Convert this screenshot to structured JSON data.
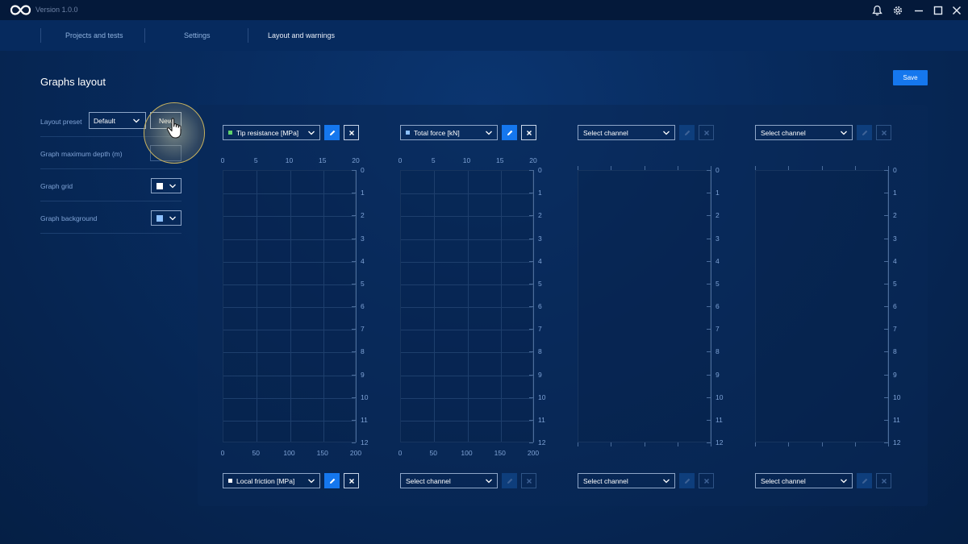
{
  "app": {
    "version": "Version 1.0.0"
  },
  "nav": {
    "tabs": [
      {
        "label": "Projects and tests"
      },
      {
        "label": "Settings"
      },
      {
        "label": "Layout and warnings"
      }
    ],
    "active_tab": "Layout and warnings"
  },
  "page": {
    "title": "Graphs layout",
    "save_label": "Save"
  },
  "settings": {
    "layout_preset_label": "Layout preset",
    "layout_preset_value": "Default",
    "new_label": "New",
    "max_depth_label": "Graph maximum depth (m)",
    "max_depth_value": "",
    "grid_label": "Graph grid",
    "grid_color": "#ffffff",
    "background_label": "Graph background",
    "background_color": "#8cc0ff"
  },
  "graphs": [
    {
      "top_channel": {
        "label": "Tip resistance [MPa]",
        "color": "#5fd16a",
        "active": true
      },
      "bottom_channel": {
        "label": "Local friction [MPa]",
        "color": "#ffffff",
        "active": true
      },
      "top_ticks": [
        "0",
        "5",
        "10",
        "15",
        "20"
      ],
      "bottom_ticks": [
        "0",
        "50",
        "100",
        "150",
        "200"
      ],
      "depth_ticks": [
        "0",
        "1",
        "2",
        "3",
        "4",
        "5",
        "6",
        "7",
        "8",
        "9",
        "10",
        "11",
        "12"
      ]
    },
    {
      "top_channel": {
        "label": "Total force [kN]",
        "color": "#8cc0ff",
        "active": true
      },
      "bottom_channel": {
        "label": "Select channel",
        "color": "",
        "active": false
      },
      "top_ticks": [
        "0",
        "5",
        "10",
        "15",
        "20"
      ],
      "bottom_ticks": [
        "0",
        "50",
        "100",
        "150",
        "200"
      ],
      "depth_ticks": [
        "0",
        "1",
        "2",
        "3",
        "4",
        "5",
        "6",
        "7",
        "8",
        "9",
        "10",
        "11",
        "12"
      ]
    },
    {
      "top_channel": {
        "label": "Select channel",
        "color": "",
        "active": false
      },
      "bottom_channel": {
        "label": "Select channel",
        "color": "",
        "active": false
      },
      "top_ticks": [],
      "bottom_ticks": [],
      "depth_ticks": [
        "0",
        "1",
        "2",
        "3",
        "4",
        "5",
        "6",
        "7",
        "8",
        "9",
        "10",
        "11",
        "12"
      ]
    },
    {
      "top_channel": {
        "label": "Select channel",
        "color": "",
        "active": false
      },
      "bottom_channel": {
        "label": "Select channel",
        "color": "",
        "active": false
      },
      "top_ticks": [],
      "bottom_ticks": [],
      "depth_ticks": [
        "0",
        "1",
        "2",
        "3",
        "4",
        "5",
        "6",
        "7",
        "8",
        "9",
        "10",
        "11",
        "12"
      ]
    }
  ]
}
